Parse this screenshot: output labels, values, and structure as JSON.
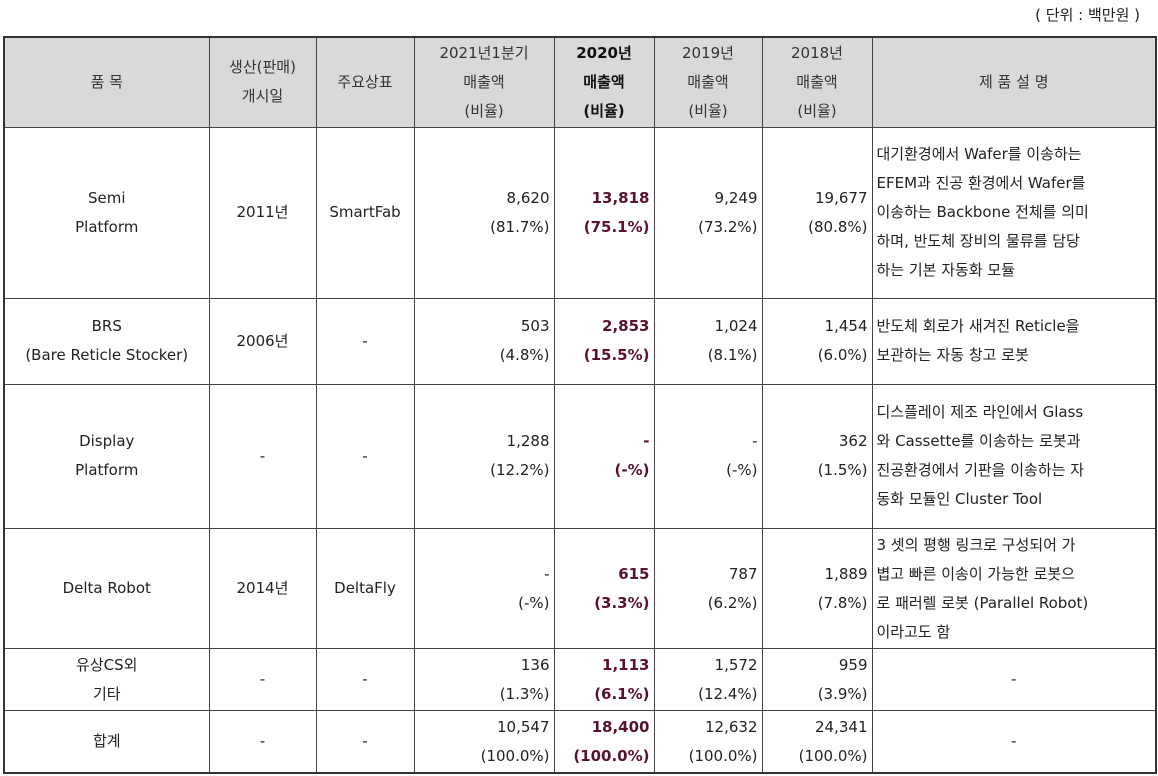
{
  "unit_note": "( 단위 : 백만원 )",
  "header": {
    "product": "품 목",
    "start_line1": "생산(판매)",
    "start_line2": "개시일",
    "brand": "주요상표",
    "q1_2021_line1": "2021년1분기",
    "q1_2021_line2": "매출액",
    "q1_2021_line3": "(비율)",
    "y2020_line1": "2020년",
    "y2020_line2": "매출액",
    "y2020_line3": "(비율)",
    "y2019_line1": "2019년",
    "y2019_line2": "매출액",
    "y2019_line3": "(비율)",
    "y2018_line1": "2018년",
    "y2018_line2": "매출액",
    "y2018_line3": "(비율)",
    "desc": "제 품 설 명"
  },
  "rows": [
    {
      "name1": "Semi",
      "name2": "Platform",
      "start": "2011년",
      "brand": "SmartFab",
      "q1_v": "8,620",
      "q1_r": "(81.7%)",
      "y2020_v": "13,818",
      "y2020_r": "(75.1%)",
      "y2019_v": "9,249",
      "y2019_r": "(73.2%)",
      "y2018_v": "19,677",
      "y2018_r": "(80.8%)",
      "desc": [
        "대기환경에서 Wafer를 이송하는",
        "EFEM과 진공 환경에서 Wafer를",
        "이송하는 Backbone 전체를 의미",
        "하며, 반도체 장비의 물류를 담당",
        "하는 기본 자동화 모듈"
      ]
    },
    {
      "name1": "BRS",
      "name2": "(Bare Reticle Stocker)",
      "start": "2006년",
      "brand": "-",
      "q1_v": "503",
      "q1_r": "(4.8%)",
      "y2020_v": "2,853",
      "y2020_r": "(15.5%)",
      "y2019_v": "1,024",
      "y2019_r": "(8.1%)",
      "y2018_v": "1,454",
      "y2018_r": "(6.0%)",
      "desc": [
        "반도체 회로가 새겨진 Reticle을",
        "보관하는 자동 창고 로봇"
      ]
    },
    {
      "name1": "Display",
      "name2": "Platform",
      "start": "-",
      "brand": "-",
      "q1_v": "1,288",
      "q1_r": "(12.2%)",
      "y2020_v": "-",
      "y2020_r": "(-%)",
      "y2019_v": "-",
      "y2019_r": "(-%)",
      "y2018_v": "362",
      "y2018_r": "(1.5%)",
      "desc": [
        "디스플레이 제조 라인에서 Glass",
        "와 Cassette를 이송하는 로봇과",
        "진공환경에서 기판을 이송하는 자",
        "동화 모듈인 Cluster Tool"
      ]
    },
    {
      "name1": "Delta Robot",
      "name2": "",
      "start": "2014년",
      "brand": "DeltaFly",
      "q1_v": "-",
      "q1_r": "(-%)",
      "y2020_v": "615",
      "y2020_r": "(3.3%)",
      "y2019_v": "787",
      "y2019_r": "(6.2%)",
      "y2018_v": "1,889",
      "y2018_r": "(7.8%)",
      "desc": [
        "3 셋의 평행 링크로 구성되어 가",
        "볍고 빠른 이송이 가능한 로봇으",
        "로 패러렐 로봇 (Parallel Robot)",
        "이라고도 함"
      ]
    },
    {
      "name1": "유상CS외",
      "name2": "기타",
      "start": "-",
      "brand": "-",
      "q1_v": "136",
      "q1_r": "(1.3%)",
      "y2020_v": "1,113",
      "y2020_r": "(6.1%)",
      "y2019_v": "1,572",
      "y2019_r": "(12.4%)",
      "y2018_v": "959",
      "y2018_r": "(3.9%)",
      "desc": [
        "-"
      ]
    },
    {
      "name1": "합계",
      "name2": "",
      "start": "-",
      "brand": "-",
      "q1_v": "10,547",
      "q1_r": "(100.0%)",
      "y2020_v": "18,400",
      "y2020_r": "(100.0%)",
      "y2019_v": "12,632",
      "y2019_r": "(100.0%)",
      "y2018_v": "24,341",
      "y2018_r": "(100.0%)",
      "desc": [
        "-"
      ]
    }
  ]
}
